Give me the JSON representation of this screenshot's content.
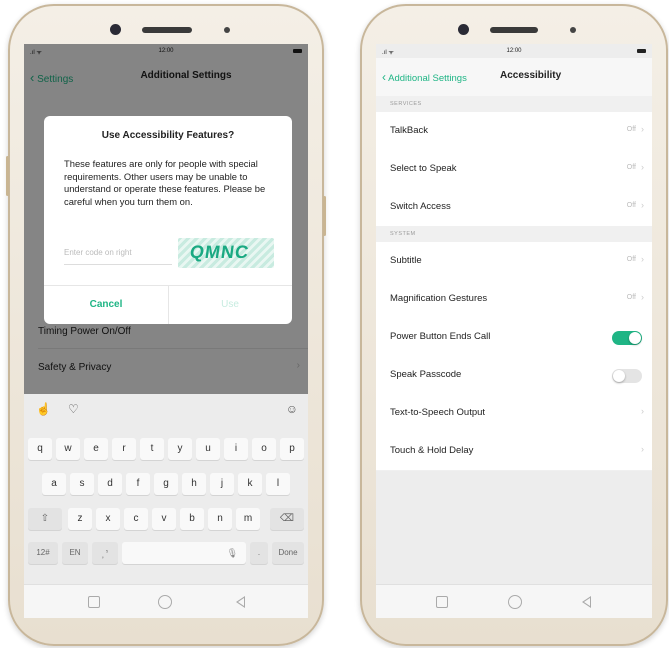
{
  "accent": "#1fb585",
  "left": {
    "status": {
      "time": "12:00"
    },
    "header": {
      "back_label": "Settings",
      "title": "Additional Settings"
    },
    "background_items": [
      "Timing Power On/Off",
      "Safety & Privacy"
    ],
    "dialog": {
      "title": "Use Accessibility Features?",
      "message": "These features are only for people with special requirements. Other users may be unable to understand or operate these features. Please be careful when you turn them on.",
      "code_placeholder": "Enter code on right",
      "captcha": "QMNC",
      "cancel": "Cancel",
      "use": "Use"
    },
    "keyboard": {
      "row1": [
        "q",
        "w",
        "e",
        "r",
        "t",
        "y",
        "u",
        "i",
        "o",
        "p"
      ],
      "row2": [
        "a",
        "s",
        "d",
        "f",
        "g",
        "h",
        "j",
        "k",
        "l"
      ],
      "row3": [
        "z",
        "x",
        "c",
        "v",
        "b",
        "n",
        "m"
      ],
      "shift": "⇧",
      "delete": "⌫",
      "num": "12#",
      "lang": "EN",
      "done": "Done"
    }
  },
  "right": {
    "status": {
      "time": "12:00"
    },
    "header": {
      "back_label": "Additional Settings",
      "title": "Accessibility"
    },
    "sections": [
      {
        "name": "SERVICES",
        "items": [
          {
            "label": "TalkBack",
            "value": "Off"
          },
          {
            "label": "Select to Speak",
            "value": "Off"
          },
          {
            "label": "Switch Access",
            "value": "Off"
          }
        ]
      },
      {
        "name": "SYSTEM",
        "items": [
          {
            "label": "Subtitle",
            "value": "Off"
          },
          {
            "label": "Magnification Gestures",
            "value": "Off"
          },
          {
            "label": "Power Button Ends Call",
            "toggle": true
          },
          {
            "label": "Speak Passcode",
            "toggle": false
          },
          {
            "label": "Text-to-Speech Output",
            "value": ""
          },
          {
            "label": "Touch & Hold Delay",
            "value": ""
          }
        ]
      }
    ]
  }
}
